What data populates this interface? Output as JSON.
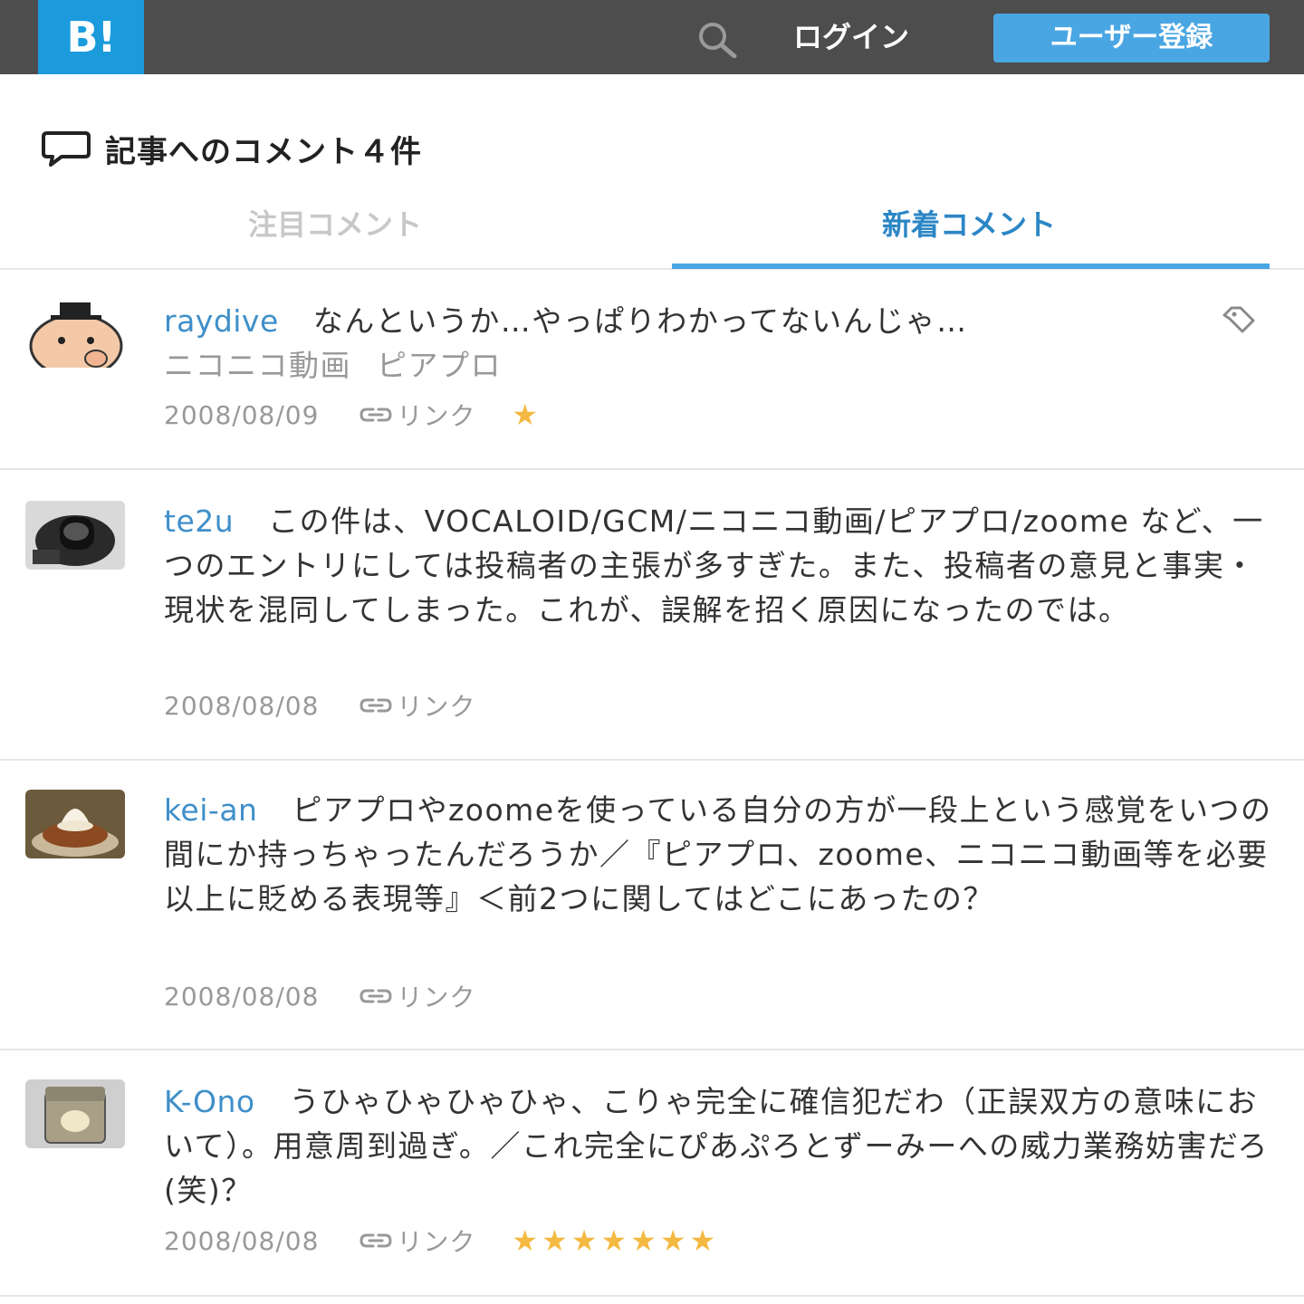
{
  "header": {
    "logo_text": "B!",
    "login_label": "ログイン",
    "signup_label": "ユーザー登録",
    "search_icon": "search-icon"
  },
  "section": {
    "title": "記事へのコメント４件"
  },
  "tabs": {
    "featured": "注目コメント",
    "new": "新着コメント",
    "active": "new"
  },
  "comments": [
    {
      "user": "raydive",
      "text": "なんというか…やっぱりわかってないんじゃ…",
      "tags": [
        "ニコニコ動画",
        "ピアプロ"
      ],
      "date": "2008/08/09",
      "link_label": "リンク",
      "stars": "★"
    },
    {
      "user": "te2u",
      "text": "この件は、VOCALOID/GCM/ニコニコ動画/ピアプロ/zoome など、一つのエントリにしては投稿者の主張が多すぎた。また、投稿者の意見と事実・現状を混同してしまった。これが、誤解を招く原因になったのでは。",
      "date": "2008/08/08",
      "link_label": "リンク",
      "stars": ""
    },
    {
      "user": "kei-an",
      "text": "ピアプロやzoomeを使っている自分の方が一段上という感覚をいつの間にか持っちゃったんだろうか／『ピアプロ、zoome、ニコニコ動画等を必要以上に貶める表現等』＜前2つに関してはどこにあったの？",
      "date": "2008/08/08",
      "link_label": "リンク",
      "stars": ""
    },
    {
      "user": "K-Ono",
      "text": "うひゃひゃひゃひゃ、こりゃ完全に確信犯だわ（正誤双方の意味において）。用意周到過ぎ。／これ完全にぴあぷろとずーみーへの威力業務妨害だろ(笑)？",
      "date": "2008/08/08",
      "link_label": "リンク",
      "stars": "★★★★★★★"
    }
  ],
  "colors": {
    "header_bg": "#4d4d4d",
    "logo_bg": "#1b9bdc",
    "accent": "#4aa6e3",
    "username": "#3f8fc9",
    "star": "#f4b942"
  }
}
